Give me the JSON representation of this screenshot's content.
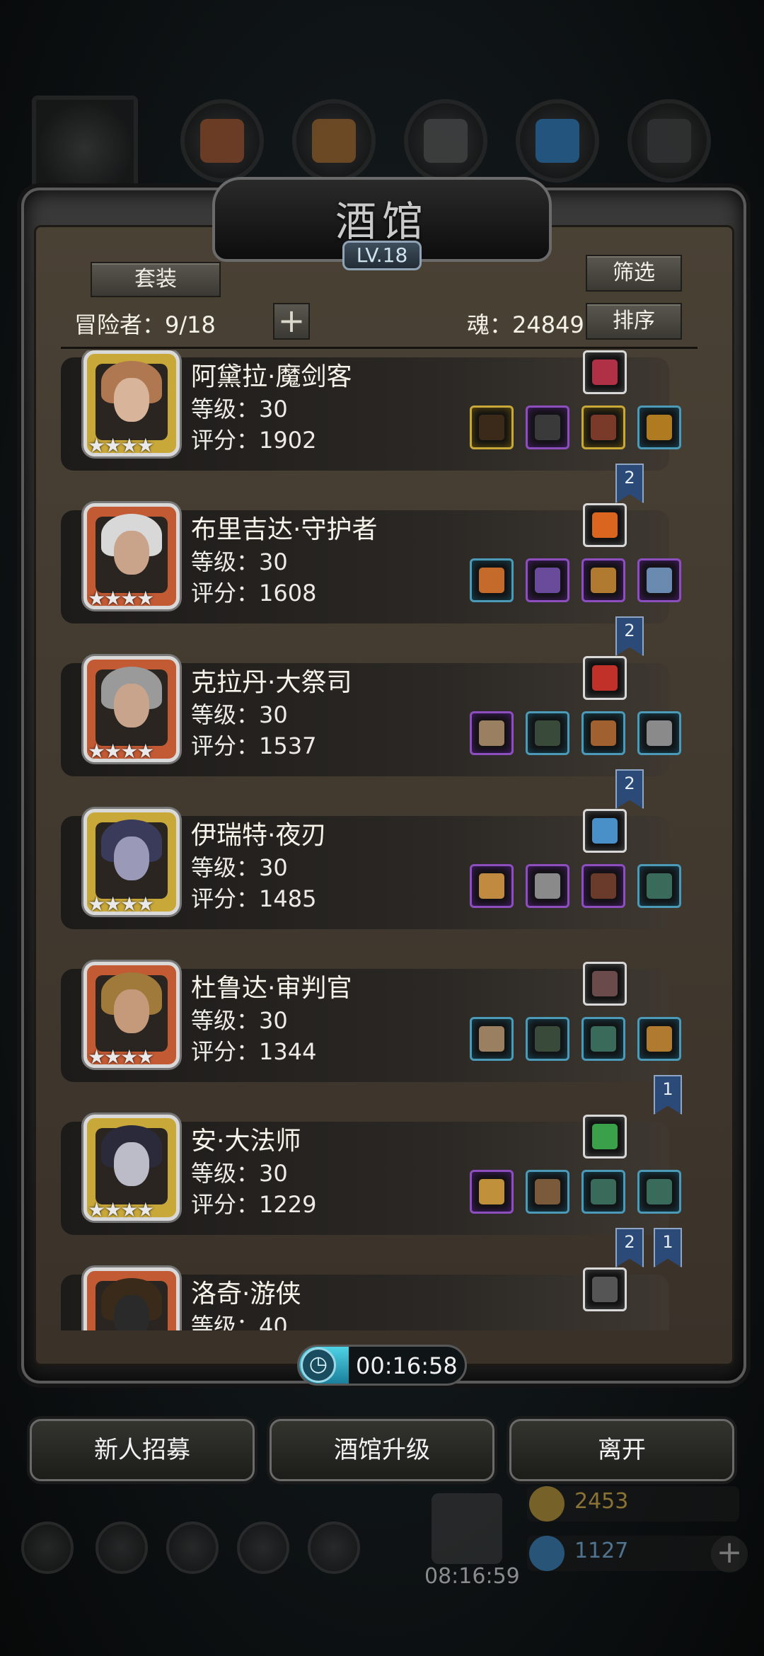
{
  "tavern": {
    "title": "酒馆",
    "level": "LV.18"
  },
  "buttons": {
    "sets": "套装",
    "filter": "筛选",
    "sort": "排序",
    "recruit": "新人招募",
    "upgrade": "酒馆升级",
    "leave": "离开"
  },
  "adventurers": {
    "label": "冒险者：9/18"
  },
  "soul": {
    "label": "魂：24849"
  },
  "timer": {
    "text": "00:16:58",
    "progress": 0.3
  },
  "heroes": [
    {
      "name": "阿黛拉·魔剑客",
      "level": "等级：30",
      "score": "评分：1902",
      "stars": "★★★★",
      "frame": "#c9a83a",
      "top_item": "#b03045",
      "slots": [
        {
          "q": "y",
          "c": "#3b2a1a"
        },
        {
          "q": "p",
          "c": "#3a3a3a"
        },
        {
          "q": "y",
          "c": "#7a3a2a"
        },
        {
          "q": "b",
          "c": "#b07a20"
        }
      ],
      "ribbons": [
        "2"
      ]
    },
    {
      "name": "布里吉达·守护者",
      "level": "等级：30",
      "score": "评分：1608",
      "stars": "★★★★",
      "frame": "#c25a34",
      "top_item": "#d9651f",
      "slots": [
        {
          "q": "b",
          "c": "#c46a2a"
        },
        {
          "q": "p",
          "c": "#6a4a9a"
        },
        {
          "q": "p",
          "c": "#b07a30"
        },
        {
          "q": "p",
          "c": "#6a8ab0"
        }
      ],
      "ribbons": [
        "2"
      ]
    },
    {
      "name": "克拉丹·大祭司",
      "level": "等级：30",
      "score": "评分：1537",
      "stars": "★★★★",
      "frame": "#c25a34",
      "top_item": "#c2302a",
      "slots": [
        {
          "q": "p",
          "c": "#9a8060"
        },
        {
          "q": "b",
          "c": "#3a4a3a"
        },
        {
          "q": "b",
          "c": "#a06030"
        },
        {
          "q": "b",
          "c": "#8a8a8a"
        }
      ],
      "ribbons": [
        "2"
      ]
    },
    {
      "name": "伊瑞特·夜刃",
      "level": "等级：30",
      "score": "评分：1485",
      "stars": "★★★★",
      "frame": "#c9a83a",
      "top_item": "#4a90c8",
      "slots": [
        {
          "q": "p",
          "c": "#c08a40"
        },
        {
          "q": "p",
          "c": "#8a8a8a"
        },
        {
          "q": "p",
          "c": "#6a3a2a"
        },
        {
          "q": "b",
          "c": "#3a6a5a"
        }
      ],
      "ribbons": []
    },
    {
      "name": "杜鲁达·审判官",
      "level": "等级：30",
      "score": "评分：1344",
      "stars": "★★★★",
      "frame": "#c25a34",
      "top_item": "#6a4a4a",
      "slots": [
        {
          "q": "b",
          "c": "#9a8060"
        },
        {
          "q": "b",
          "c": "#3a4a3a"
        },
        {
          "q": "b",
          "c": "#3a6a5a"
        },
        {
          "q": "b",
          "c": "#b07a30"
        }
      ],
      "ribbons": [
        "1"
      ]
    },
    {
      "name": "安·大法师",
      "level": "等级：30",
      "score": "评分：1229",
      "stars": "★★★★",
      "frame": "#c9a83a",
      "top_item": "#3aa04a",
      "slots": [
        {
          "q": "p",
          "c": "#c0903a"
        },
        {
          "q": "b",
          "c": "#7a5a3a"
        },
        {
          "q": "b",
          "c": "#3a6a5a"
        },
        {
          "q": "b",
          "c": "#3a6a5a"
        }
      ],
      "ribbons": [
        "2",
        "1"
      ]
    },
    {
      "name": "洛奇·游侠",
      "level": "等级：40",
      "score": "",
      "stars": "★★★★",
      "frame": "#c25a34",
      "top_item": "#555555",
      "slots": [],
      "ribbons": []
    }
  ],
  "background": {
    "resource1": "2453",
    "resource2": "1127",
    "clock": "08:16:59"
  }
}
